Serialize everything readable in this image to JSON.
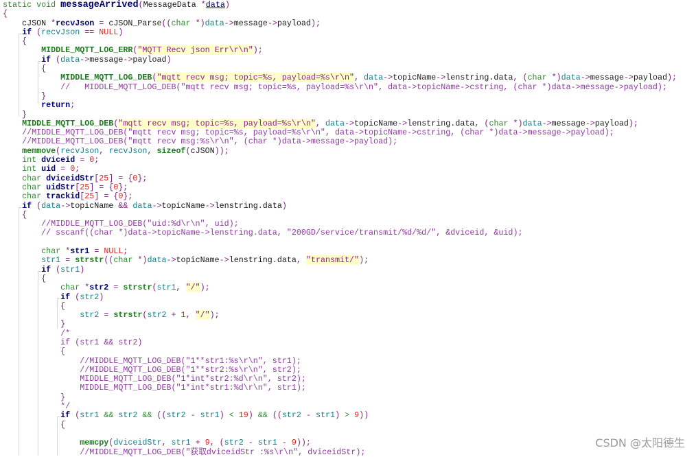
{
  "editor": {
    "lines": [
      [
        [
          "k",
          "static void "
        ],
        [
          "fn",
          "messageArrived"
        ],
        [
          "p",
          "("
        ],
        [
          "t",
          "MessageData "
        ],
        [
          "p",
          "*"
        ],
        [
          "du",
          "data"
        ],
        [
          "p",
          ")"
        ]
      ],
      [
        [
          "p",
          "{"
        ]
      ],
      [
        [
          "t",
          "    cJSON "
        ],
        [
          "p",
          "*"
        ],
        [
          "d",
          "recvJson"
        ],
        [
          "p",
          " = "
        ],
        [
          "t",
          "cJSON_Parse"
        ],
        [
          "p",
          "(("
        ],
        [
          "k",
          "char"
        ],
        [
          "p",
          " *)"
        ],
        [
          "v",
          "data"
        ],
        [
          "p",
          "->"
        ],
        [
          "t",
          "message"
        ],
        [
          "p",
          "->"
        ],
        [
          "t",
          "payload"
        ],
        [
          "p",
          ");"
        ]
      ],
      [
        [
          "t",
          "    "
        ],
        [
          "b",
          "if"
        ],
        [
          "p",
          " ("
        ],
        [
          "v",
          "recvJson"
        ],
        [
          "p",
          " == "
        ],
        [
          "n",
          "NULL"
        ],
        [
          "p",
          ")"
        ]
      ],
      [
        [
          "p",
          "    {"
        ]
      ],
      [
        [
          "t",
          "        "
        ],
        [
          "f",
          "MIDDLE_MQTT_LOG_ERR"
        ],
        [
          "p",
          "("
        ],
        [
          "s",
          "\"MQTT Recv json Err\\r\\n\""
        ],
        [
          "p",
          ");"
        ]
      ],
      [
        [
          "t",
          "        "
        ],
        [
          "b",
          "if"
        ],
        [
          "p",
          " ("
        ],
        [
          "v",
          "data"
        ],
        [
          "p",
          "->"
        ],
        [
          "t",
          "message"
        ],
        [
          "p",
          "->"
        ],
        [
          "t",
          "payload"
        ],
        [
          "p",
          ")"
        ]
      ],
      [
        [
          "p",
          "        {"
        ]
      ],
      [
        [
          "t",
          "            "
        ],
        [
          "f",
          "MIDDLE_MQTT_LOG_DEB"
        ],
        [
          "p",
          "("
        ],
        [
          "s",
          "\"mqtt recv msg; topic=%s, payload=%s\\r\\n\""
        ],
        [
          "p",
          ", "
        ],
        [
          "v",
          "data"
        ],
        [
          "p",
          "->"
        ],
        [
          "t",
          "topicName"
        ],
        [
          "p",
          "->"
        ],
        [
          "t",
          "lenstring.data"
        ],
        [
          "p",
          ", ("
        ],
        [
          "k",
          "char"
        ],
        [
          "p",
          " *)"
        ],
        [
          "v",
          "data"
        ],
        [
          "p",
          "->"
        ],
        [
          "t",
          "message"
        ],
        [
          "p",
          "->"
        ],
        [
          "t",
          "payload"
        ],
        [
          "p",
          ");"
        ]
      ],
      [
        [
          "t",
          "            "
        ],
        [
          "c",
          "//   MIDDLE_MQTT_LOG_DEB(\"mqtt recv msg; topic=%s, payload=%s\\r\\n\", data->topicName->cstring, (char *)data->message->payload);"
        ]
      ],
      [
        [
          "p",
          "        }"
        ]
      ],
      [
        [
          "t",
          "        "
        ],
        [
          "b",
          "return"
        ],
        [
          "p",
          ";"
        ]
      ],
      [
        [
          "p",
          "    }"
        ]
      ],
      [
        [
          "t",
          "    "
        ],
        [
          "f",
          "MIDDLE_MQTT_LOG_DEB"
        ],
        [
          "p",
          "("
        ],
        [
          "s",
          "\"mqtt recv msg; topic=%s, payload=%s\\r\\n\""
        ],
        [
          "p",
          ", "
        ],
        [
          "v",
          "data"
        ],
        [
          "p",
          "->"
        ],
        [
          "t",
          "topicName"
        ],
        [
          "p",
          "->"
        ],
        [
          "t",
          "lenstring.data"
        ],
        [
          "p",
          ", ("
        ],
        [
          "k",
          "char"
        ],
        [
          "p",
          " *)"
        ],
        [
          "v",
          "data"
        ],
        [
          "p",
          "->"
        ],
        [
          "t",
          "message"
        ],
        [
          "p",
          "->"
        ],
        [
          "t",
          "payload"
        ],
        [
          "p",
          ");"
        ]
      ],
      [
        [
          "t",
          "    "
        ],
        [
          "c",
          "//MIDDLE_MQTT_LOG_DEB(\"mqtt recv msg; topic=%s, payload=%s\\r\\n\", data->topicName->cstring, (char *)data->message->payload);"
        ]
      ],
      [
        [
          "t",
          "    "
        ],
        [
          "c",
          "//MIDDLE_MQTT_LOG_DEB(\"mqtt recv msg:%s\\r\\n\", (char *)data->message->payload);"
        ]
      ],
      [
        [
          "t",
          "    "
        ],
        [
          "f",
          "memmove"
        ],
        [
          "p",
          "("
        ],
        [
          "v",
          "recvJson"
        ],
        [
          "p",
          ", "
        ],
        [
          "v",
          "recvJson"
        ],
        [
          "p",
          ", "
        ],
        [
          "f",
          "sizeof"
        ],
        [
          "p",
          "("
        ],
        [
          "t",
          "cJSON"
        ],
        [
          "p",
          "));"
        ]
      ],
      [
        [
          "t",
          "    "
        ],
        [
          "k",
          "int "
        ],
        [
          "d",
          "dviceid"
        ],
        [
          "p",
          " = "
        ],
        [
          "n",
          "0"
        ],
        [
          "p",
          ";"
        ]
      ],
      [
        [
          "t",
          "    "
        ],
        [
          "k",
          "int "
        ],
        [
          "d",
          "uid"
        ],
        [
          "p",
          " = "
        ],
        [
          "n",
          "0"
        ],
        [
          "p",
          ";"
        ]
      ],
      [
        [
          "t",
          "    "
        ],
        [
          "k",
          "char "
        ],
        [
          "d",
          "dviceidStr"
        ],
        [
          "p",
          "["
        ],
        [
          "n",
          "25"
        ],
        [
          "p",
          "] = {"
        ],
        [
          "n",
          "0"
        ],
        [
          "p",
          "};"
        ]
      ],
      [
        [
          "t",
          "    "
        ],
        [
          "k",
          "char "
        ],
        [
          "d",
          "uidStr"
        ],
        [
          "p",
          "["
        ],
        [
          "n",
          "25"
        ],
        [
          "p",
          "] = {"
        ],
        [
          "n",
          "0"
        ],
        [
          "p",
          "};"
        ]
      ],
      [
        [
          "t",
          "    "
        ],
        [
          "k",
          "char "
        ],
        [
          "d",
          "trackid"
        ],
        [
          "p",
          "["
        ],
        [
          "n",
          "25"
        ],
        [
          "p",
          "] = {"
        ],
        [
          "n",
          "0"
        ],
        [
          "p",
          "};"
        ]
      ],
      [
        [
          "t",
          "    "
        ],
        [
          "b",
          "if"
        ],
        [
          "p",
          " ("
        ],
        [
          "v",
          "data"
        ],
        [
          "p",
          "->"
        ],
        [
          "t",
          "topicName"
        ],
        [
          "p",
          " && "
        ],
        [
          "v",
          "data"
        ],
        [
          "p",
          "->"
        ],
        [
          "t",
          "topicName"
        ],
        [
          "p",
          "->"
        ],
        [
          "t",
          "lenstring.data"
        ],
        [
          "p",
          ")"
        ]
      ],
      [
        [
          "p",
          "    {"
        ]
      ],
      [
        [
          "t",
          "        "
        ],
        [
          "c",
          "//MIDDLE_MQTT_LOG_DEB(\"uid:%d\\r\\n\", uid);"
        ]
      ],
      [
        [
          "t",
          "        "
        ],
        [
          "c",
          "// sscanf((char *)data->topicName->lenstring.data, \"200GD/service/transmit/%d/%d/\", &dviceid, &uid);"
        ]
      ],
      [
        [
          "t",
          " "
        ]
      ],
      [
        [
          "t",
          "        "
        ],
        [
          "k",
          "char "
        ],
        [
          "p",
          "*"
        ],
        [
          "d",
          "str1"
        ],
        [
          "p",
          " = "
        ],
        [
          "n",
          "NULL"
        ],
        [
          "p",
          ";"
        ]
      ],
      [
        [
          "t",
          "        "
        ],
        [
          "v",
          "str1"
        ],
        [
          "p",
          " = "
        ],
        [
          "f",
          "strstr"
        ],
        [
          "p",
          "(("
        ],
        [
          "k",
          "char"
        ],
        [
          "p",
          " *)"
        ],
        [
          "v",
          "data"
        ],
        [
          "p",
          "->"
        ],
        [
          "t",
          "topicName"
        ],
        [
          "p",
          "->"
        ],
        [
          "t",
          "lenstring.data"
        ],
        [
          "p",
          ", "
        ],
        [
          "s",
          "\"transmit/\""
        ],
        [
          "p",
          ");"
        ]
      ],
      [
        [
          "t",
          "        "
        ],
        [
          "b",
          "if"
        ],
        [
          "p",
          " ("
        ],
        [
          "v",
          "str1"
        ],
        [
          "p",
          ")"
        ]
      ],
      [
        [
          "p",
          "        {"
        ]
      ],
      [
        [
          "t",
          "            "
        ],
        [
          "k",
          "char "
        ],
        [
          "p",
          "*"
        ],
        [
          "d",
          "str2"
        ],
        [
          "p",
          " = "
        ],
        [
          "f",
          "strstr"
        ],
        [
          "p",
          "("
        ],
        [
          "v",
          "str1"
        ],
        [
          "p",
          ", "
        ],
        [
          "s",
          "\"/\""
        ],
        [
          "p",
          ");"
        ]
      ],
      [
        [
          "t",
          "            "
        ],
        [
          "b",
          "if"
        ],
        [
          "p",
          " ("
        ],
        [
          "v",
          "str2"
        ],
        [
          "p",
          ")"
        ]
      ],
      [
        [
          "p",
          "            {"
        ]
      ],
      [
        [
          "t",
          "                "
        ],
        [
          "v",
          "str2"
        ],
        [
          "p",
          " = "
        ],
        [
          "f",
          "strstr"
        ],
        [
          "p",
          "("
        ],
        [
          "v",
          "str2"
        ],
        [
          "p",
          " + "
        ],
        [
          "n",
          "1"
        ],
        [
          "p",
          ", "
        ],
        [
          "s",
          "\"/\""
        ],
        [
          "p",
          ");"
        ]
      ],
      [
        [
          "p",
          "            }"
        ]
      ],
      [
        [
          "t",
          "            "
        ],
        [
          "c",
          "/*"
        ]
      ],
      [
        [
          "t",
          "            "
        ],
        [
          "c",
          "if (str1 && str2)"
        ]
      ],
      [
        [
          "t",
          "            "
        ],
        [
          "c",
          "{"
        ]
      ],
      [
        [
          "t",
          "                "
        ],
        [
          "c",
          "//MIDDLE_MQTT_LOG_DEB(\"1**str1:%s\\r\\n\", str1);"
        ]
      ],
      [
        [
          "t",
          "                "
        ],
        [
          "c",
          "//MIDDLE_MQTT_LOG_DEB(\"1**str2:%s\\r\\n\", str2);"
        ]
      ],
      [
        [
          "t",
          "                "
        ],
        [
          "c",
          "MIDDLE_MQTT_LOG_DEB(\"1*int*str2:%d\\r\\n\", str2);"
        ]
      ],
      [
        [
          "t",
          "                "
        ],
        [
          "c",
          "MIDDLE_MQTT_LOG_DEB(\"1*int*str1:%d\\r\\n\", str1);"
        ]
      ],
      [
        [
          "t",
          "            "
        ],
        [
          "c",
          "}"
        ]
      ],
      [
        [
          "t",
          "            "
        ],
        [
          "c",
          "*/"
        ]
      ],
      [
        [
          "t",
          "            "
        ],
        [
          "b",
          "if"
        ],
        [
          "p",
          " ("
        ],
        [
          "v",
          "str1"
        ],
        [
          "k",
          " && "
        ],
        [
          "v",
          "str2"
        ],
        [
          "k",
          " && "
        ],
        [
          "p",
          "(("
        ],
        [
          "v",
          "str2"
        ],
        [
          "p",
          " - "
        ],
        [
          "v",
          "str1"
        ],
        [
          "p",
          ") "
        ],
        [
          "k",
          "<"
        ],
        [
          "t",
          " "
        ],
        [
          "n",
          "19"
        ],
        [
          "p",
          ") "
        ],
        [
          "k",
          "&&"
        ],
        [
          "p",
          " (("
        ],
        [
          "v",
          "str2"
        ],
        [
          "p",
          " - "
        ],
        [
          "v",
          "str1"
        ],
        [
          "p",
          ") "
        ],
        [
          "k",
          ">"
        ],
        [
          "t",
          " "
        ],
        [
          "n",
          "9"
        ],
        [
          "p",
          "))"
        ]
      ],
      [
        [
          "p",
          "            {"
        ]
      ],
      [
        [
          "t",
          " "
        ]
      ],
      [
        [
          "t",
          "                "
        ],
        [
          "f",
          "memcpy"
        ],
        [
          "p",
          "("
        ],
        [
          "v",
          "dviceidStr"
        ],
        [
          "p",
          ", "
        ],
        [
          "v",
          "str1"
        ],
        [
          "p",
          " + "
        ],
        [
          "n",
          "9"
        ],
        [
          "p",
          ", ("
        ],
        [
          "v",
          "str2"
        ],
        [
          "p",
          " - "
        ],
        [
          "v",
          "str1"
        ],
        [
          "p",
          " - "
        ],
        [
          "n",
          "9"
        ],
        [
          "p",
          "));"
        ]
      ],
      [
        [
          "t",
          "                "
        ],
        [
          "c",
          "//MIDDLE_MQTT_LOG_DEB(\"获取dviceidStr :%s\\r\\n\", dviceidStr);"
        ]
      ]
    ]
  },
  "watermark": "CSDN @太阳德生"
}
